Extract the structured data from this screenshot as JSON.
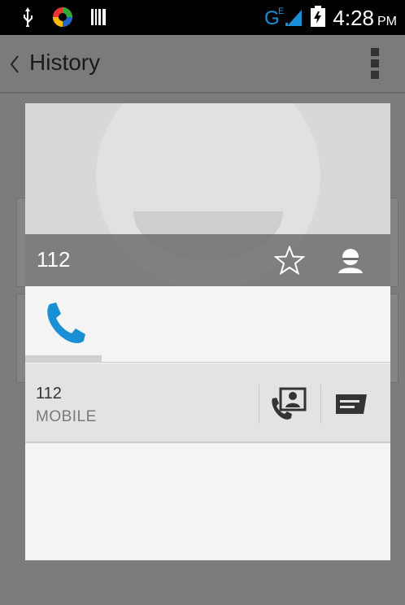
{
  "status_bar": {
    "icons_left": [
      "usb-icon",
      "app-notification-icon",
      "barcode-icon"
    ],
    "network": "G",
    "network_sub": "E",
    "time": "4:28",
    "ampm": "PM"
  },
  "app_bar": {
    "title": "History"
  },
  "contact_card": {
    "name": "112",
    "tabs": [
      "phone-tab"
    ],
    "entries": [
      {
        "number": "112",
        "type": "MOBILE"
      }
    ]
  },
  "colors": {
    "accent": "#1a8fd6",
    "scrim": "#7c7c7c",
    "dialog_bg": "#f4f4f4"
  }
}
